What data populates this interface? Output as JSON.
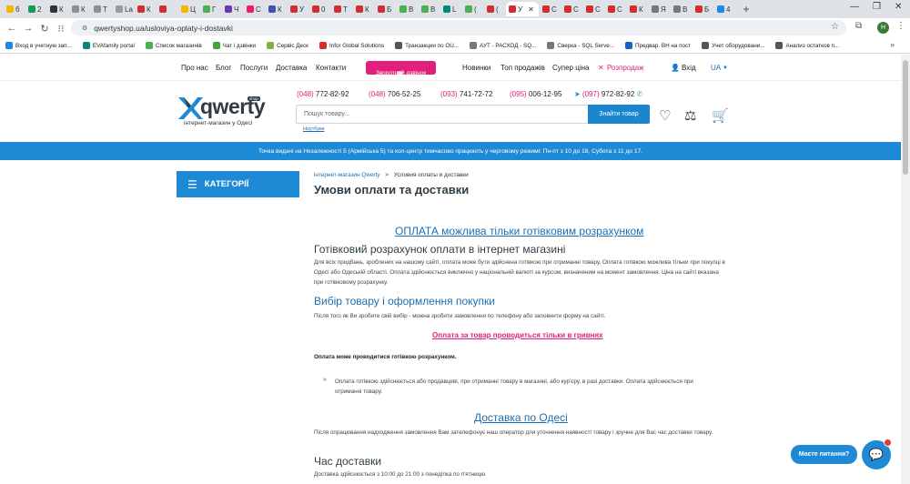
{
  "browser": {
    "tabs": [
      {
        "label": "б",
        "color": "#f4b400"
      },
      {
        "label": "2",
        "color": "#0f9d58"
      },
      {
        "label": "К",
        "color": "#333333"
      },
      {
        "label": "К",
        "color": "#8e8e8e"
      },
      {
        "label": "Т",
        "color": "#8e8e8e"
      },
      {
        "label": "La",
        "color": "#999999"
      },
      {
        "label": "К",
        "color": "#d32f2f"
      },
      {
        "label": "",
        "color": "#d32f2f"
      },
      {
        "label": "Ц",
        "color": "#f4b400"
      },
      {
        "label": "Г",
        "color": "#4caf50"
      },
      {
        "label": "Ч",
        "color": "#673ab7"
      },
      {
        "label": "С",
        "color": "#e91e63"
      },
      {
        "label": "К",
        "color": "#3f51b5"
      },
      {
        "label": "У",
        "color": "#d32f2f"
      },
      {
        "label": "0",
        "color": "#d32f2f"
      },
      {
        "label": "Т",
        "color": "#d32f2f"
      },
      {
        "label": "К",
        "color": "#d32f2f"
      },
      {
        "label": "Б",
        "color": "#d32f2f"
      },
      {
        "label": "В",
        "color": "#4caf50"
      },
      {
        "label": "В",
        "color": "#4caf50"
      },
      {
        "label": "L",
        "color": "#00897b"
      },
      {
        "label": "(",
        "color": "#4caf50"
      },
      {
        "label": "(",
        "color": "#d32f2f"
      },
      {
        "label": "У",
        "color": "#d32f2f"
      },
      {
        "label": "С",
        "color": "#d32f2f"
      },
      {
        "label": "С",
        "color": "#d32f2f"
      },
      {
        "label": "С",
        "color": "#d32f2f"
      },
      {
        "label": "С",
        "color": "#d32f2f"
      },
      {
        "label": "К",
        "color": "#d32f2f"
      },
      {
        "label": "Я",
        "color": "#777777"
      },
      {
        "label": "В",
        "color": "#777777"
      },
      {
        "label": "Б",
        "color": "#d32f2f"
      },
      {
        "label": "4",
        "color": "#1e88e5"
      }
    ],
    "active_tab_index": 23,
    "new_tab": "+",
    "url": "qwertyshop.ua/usloviya-oplaty-i-dostavki",
    "bookmarks": [
      {
        "label": "Вход в учетную зап...",
        "color": "#1e88e5"
      },
      {
        "label": "EVAfamily portal",
        "color": "#00897b"
      },
      {
        "label": "Список магазинів",
        "color": "#4caf50"
      },
      {
        "label": "Чат і дзвінки",
        "color": "#43a047"
      },
      {
        "label": "Сервіс Деск",
        "color": "#7cb342"
      },
      {
        "label": "Infor Global Solutions",
        "color": "#d32f2f"
      },
      {
        "label": "Транзакции по OU...",
        "color": "#555555"
      },
      {
        "label": "АУТ - РАСХОД - SQ...",
        "color": "#777777"
      },
      {
        "label": "Сверка - SQL Serve...",
        "color": "#777777"
      },
      {
        "label": "Предвар. ВН на пост",
        "color": "#1565c0"
      },
      {
        "label": "Учет оборудовани...",
        "color": "#555555"
      },
      {
        "label": "Анализ остатков п...",
        "color": "#555555"
      }
    ],
    "profile_initial": "H"
  },
  "site": {
    "top_nav": [
      "Про нас",
      "Блог",
      "Послуги",
      "Доставка",
      "Контакти"
    ],
    "callback_label": "Зворотний дзвінок",
    "right_nav": [
      "Новинки",
      "Топ продажів",
      "Супер ціна",
      "Розпродаж"
    ],
    "login": "Вхід",
    "lang": "UA",
    "logo_text": "qwerty",
    "logo_badge": "shop",
    "logo_tagline": "інтернет-магазин у Одесі",
    "phones": [
      {
        "code": "(048)",
        "num": "772-82-92"
      },
      {
        "code": "(048)",
        "num": "706-52-25"
      },
      {
        "code": "(093)",
        "num": "741-72-72"
      },
      {
        "code": "(095)",
        "num": "006-12-95"
      },
      {
        "code": "(097)",
        "num": "972-82-92"
      }
    ],
    "search_placeholder": "Пошук товару...",
    "search_button": "Знайти товар",
    "search_hint": "Ноутбуки",
    "banner": "Точка видачі на Незалежності 5 (Армійська 5) та кол-центр тимчасово працюють у черговому режимі: Пн-пт з 10 до 18, Субота з 11 до 17.",
    "categories_label": "КАТЕГОРІЇ",
    "breadcrumb": [
      "інтернет-магазин Qwerty",
      "Условия оплаты и доставки"
    ],
    "breadcrumb_sep": ">",
    "page_title": "Умови оплати та доставки",
    "heading_cash": "ОПЛАТА можлива тільки готівковим розрахунком",
    "h_cash_payment": "Готівковий розрахунок оплати в інтернет магазині",
    "p_cash": "Для всіх придбань, зроблених на нашому сайті, оплата може бути здійснена готівкою при отриманні товару. Оплата готівкою можлива тільки при покупці в Одесі або Одеській області. Оплата здійснюється виключно у національній валюті за курсом, визначеним на момент замовлення. Ціна на сайті вказана при готівковому розрахунку.",
    "h_choice": "Вибір товару і оформлення покупки",
    "p_choice": "Після того як Ви зробите свій вибір - можна зробити замовлення по телефону або заповнити форму на сайті.",
    "link_uah": "Оплата за товар проводиться тільки в гривнях",
    "bold_cash": "Оплата може проводитися готівкою розрахунком.",
    "bullet_marker": "»",
    "bullet_text": "Оплата готівкою здійснюється або продавцеві, при отриманні товару в магазині, або кур'єру, в разі доставки. Оплата здійснюється при отриманні товару.",
    "heading_delivery": "Доставка по Одесі",
    "p_delivery": "Після опрацювання надходження замовлення Вам зателефонує наш оператор для уточнення наявності товару і зручне для Вас час доставки товару.",
    "h_time": "Час доставки",
    "p_time": "Доставка здійснюється з 10:00 до 21:00 з понеділка по п'ятницю.",
    "chat_label": "Маєте питання?"
  }
}
